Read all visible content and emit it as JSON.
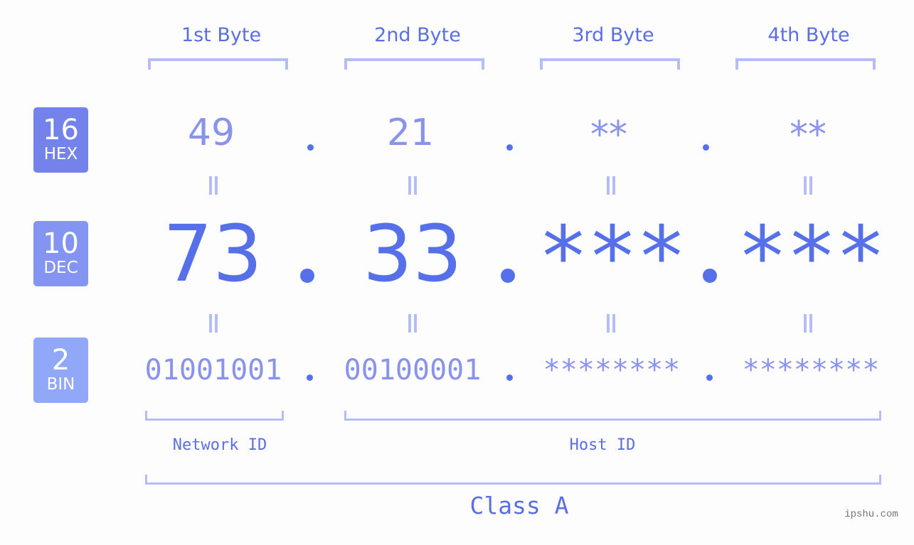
{
  "byte_headers": [
    "1st Byte",
    "2nd Byte",
    "3rd Byte",
    "4th Byte"
  ],
  "rows": {
    "hex": {
      "base": "16",
      "label": "HEX",
      "values": [
        "49",
        "21",
        "**",
        "**"
      ],
      "badge_color": "#7483eb"
    },
    "dec": {
      "base": "10",
      "label": "DEC",
      "values": [
        "73",
        "33",
        "***",
        "***"
      ],
      "badge_color": "#8494f2"
    },
    "bin": {
      "base": "2",
      "label": "BIN",
      "values": [
        "01001001",
        "00100001",
        "********",
        "********"
      ],
      "badge_color": "#91a8f8"
    }
  },
  "segments": {
    "network_id": "Network ID",
    "host_id": "Host ID",
    "class": "Class A"
  },
  "watermark": "ipshu.com",
  "colors": {
    "primary_text": "#5670ea",
    "light_text": "#8993ee",
    "bracket": "#b4bdf7",
    "background": "#fcfdfc"
  }
}
